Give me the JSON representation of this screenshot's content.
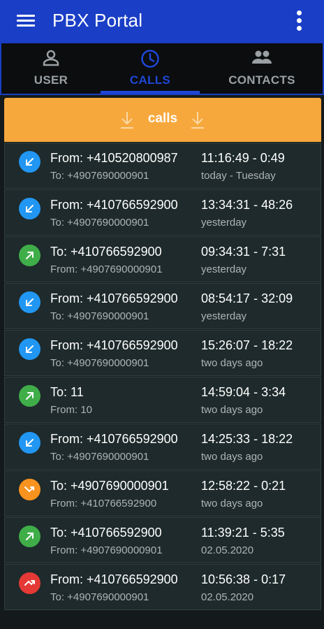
{
  "appbar": {
    "title": "PBX Portal",
    "color": "#1a3ec6",
    "menu_icon": "hamburger-menu-icon",
    "more_icon": "more-vert-icon"
  },
  "tabs": [
    {
      "label": "USER",
      "icon": "person-icon",
      "active": false
    },
    {
      "label": "CALLS",
      "icon": "clock-icon",
      "active": true
    },
    {
      "label": "CONTACTS",
      "icon": "people-icon",
      "active": false
    }
  ],
  "calls_header": {
    "label": "calls",
    "icon": "download-arrow-icon",
    "color": "#f7a83c"
  },
  "status_colors": {
    "incoming": "#2196f3",
    "outgoing": "#3fae49",
    "forwarded": "#f7931e",
    "missed": "#e53935"
  },
  "calls": [
    {
      "type": "incoming",
      "primary": "From: +410520800987",
      "secondary": "To: +4907690000901",
      "time": "11:16:49 - 0:49",
      "when": "today - Tuesday"
    },
    {
      "type": "incoming",
      "primary": "From: +410766592900",
      "secondary": "To: +4907690000901",
      "time": "13:34:31 - 48:26",
      "when": "yesterday"
    },
    {
      "type": "outgoing",
      "primary": "To: +410766592900",
      "secondary": "From: +4907690000901",
      "time": "09:34:31 - 7:31",
      "when": "yesterday"
    },
    {
      "type": "incoming",
      "primary": "From: +410766592900",
      "secondary": "To: +4907690000901",
      "time": "08:54:17 - 32:09",
      "when": "yesterday"
    },
    {
      "type": "incoming",
      "primary": "From: +410766592900",
      "secondary": "To: +4907690000901",
      "time": "15:26:07 - 18:22",
      "when": "two days ago"
    },
    {
      "type": "outgoing",
      "primary": "To: 11",
      "secondary": "From: 10",
      "time": "14:59:04 - 3:34",
      "when": "two days ago"
    },
    {
      "type": "incoming",
      "primary": "From: +410766592900",
      "secondary": "To: +4907690000901",
      "time": "14:25:33 - 18:22",
      "when": "two days ago"
    },
    {
      "type": "forwarded",
      "primary": "To: +4907690000901",
      "secondary": "From: +410766592900",
      "time": "12:58:22 - 0:21",
      "when": "two days ago"
    },
    {
      "type": "outgoing",
      "primary": "To: +410766592900",
      "secondary": "From: +4907690000901",
      "time": "11:39:21 - 5:35",
      "when": "02.05.2020"
    },
    {
      "type": "missed",
      "primary": "From: +410766592900",
      "secondary": "To: +4907690000901",
      "time": "10:56:38 - 0:17",
      "when": "02.05.2020"
    }
  ]
}
